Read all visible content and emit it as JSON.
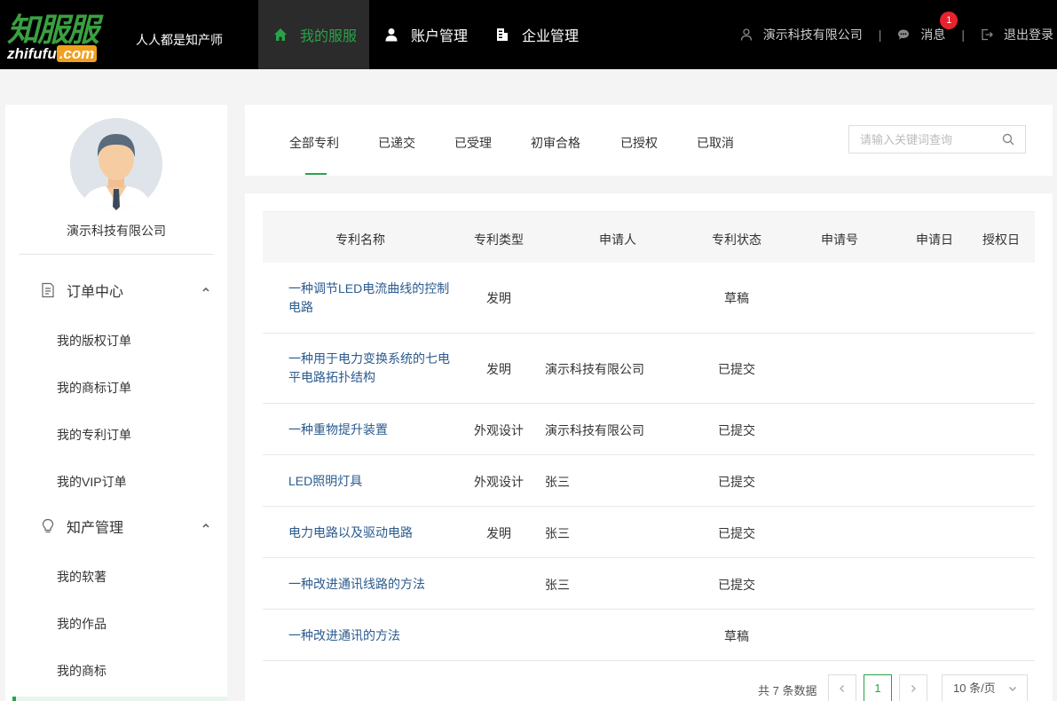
{
  "header": {
    "logo_cn": "知服服",
    "logo_en_main": "zhifufu",
    "logo_en_suffix": ".com",
    "slogan": "人人都是知产师",
    "nav": [
      {
        "label": "我的服服",
        "icon": "home-icon",
        "active": true
      },
      {
        "label": "账户管理",
        "icon": "user-icon",
        "active": false
      },
      {
        "label": "企业管理",
        "icon": "building-icon",
        "active": false
      }
    ],
    "company": "演示科技有限公司",
    "messages_label": "消息",
    "messages_badge": "1",
    "logout_label": "退出登录",
    "separator": "|"
  },
  "sidebar": {
    "company_name": "演示科技有限公司",
    "groups": [
      {
        "label": "订单中心",
        "icon": "document-icon",
        "items": [
          "我的版权订单",
          "我的商标订单",
          "我的专利订单",
          "我的VIP订单"
        ]
      },
      {
        "label": "知产管理",
        "icon": "lightbulb-icon",
        "items": [
          "我的软著",
          "我的作品",
          "我的商标"
        ]
      }
    ]
  },
  "tabs": {
    "items": [
      "全部专利",
      "已递交",
      "已受理",
      "初审合格",
      "已授权",
      "已取消"
    ],
    "active_index": 0,
    "search_placeholder": "请输入关键词查询"
  },
  "table": {
    "headers": [
      "专利名称",
      "专利类型",
      "申请人",
      "专利状态",
      "申请号",
      "申请日",
      "授权日"
    ],
    "rows": [
      {
        "name": "一种调节LED电流曲线的控制电路",
        "type": "发明",
        "applicant": "",
        "status": "草稿"
      },
      {
        "name": "一种用于电力变换系统的七电平电路拓扑结构",
        "type": "发明",
        "applicant": "演示科技有限公司",
        "status": "已提交"
      },
      {
        "name": "一种重物提升装置",
        "type": "外观设计",
        "applicant": "演示科技有限公司",
        "status": "已提交"
      },
      {
        "name": "LED照明灯具",
        "type": "外观设计",
        "applicant": "张三",
        "status": "已提交"
      },
      {
        "name": "电力电路以及驱动电路",
        "type": "发明",
        "applicant": "张三",
        "status": "已提交"
      },
      {
        "name": "一种改进通讯线路的方法",
        "type": "",
        "applicant": "张三",
        "status": "已提交"
      },
      {
        "name": "一种改进通讯的方法",
        "type": "",
        "applicant": "",
        "status": "草稿"
      }
    ]
  },
  "pagination": {
    "total_text": "共 7 条数据",
    "prev": "<",
    "current_page": "1",
    "next": ">",
    "page_size": "10 条/页"
  },
  "colors": {
    "accent": "#29a348",
    "link": "#2b5b8e",
    "header_bg": "#000000",
    "badge": "#e8232e"
  }
}
